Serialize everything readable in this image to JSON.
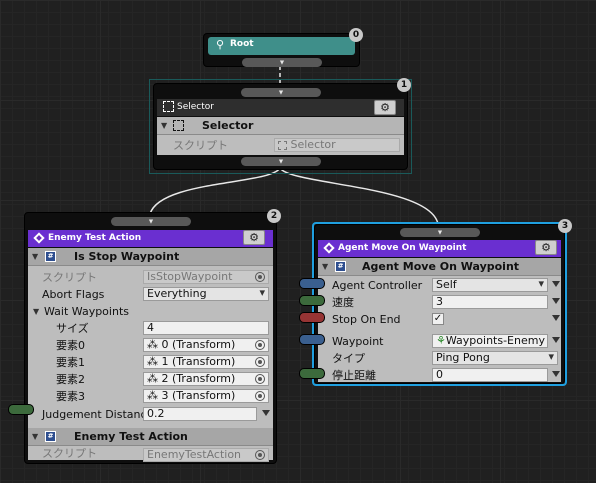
{
  "colors": {
    "root_title": "#3f8f8a",
    "selector_title": "#2e2e2e",
    "action_title": "#6a2fd0",
    "selected_outline": "#1f9fdf",
    "port_blue": "#3a5f8f",
    "port_green": "#3c6a3c",
    "port_red": "#963434"
  },
  "root": {
    "title": "Root",
    "badge": "0",
    "icon": "map-pin-icon"
  },
  "selector": {
    "title": "Selector",
    "badge": "1",
    "header": "Selector",
    "script_label": "スクリプト",
    "script_value": "Selector",
    "icon": "selector-icon"
  },
  "enemy": {
    "title": "Enemy Test Action",
    "badge": "2",
    "comp1_header": "Is Stop Waypoint",
    "script_label": "スクリプト",
    "script_value": "IsStopWaypoint",
    "abort_label": "Abort Flags",
    "abort_value": "Everything",
    "wait_label": "Wait Waypoints",
    "size_label": "サイズ",
    "size_value": "4",
    "elements": [
      {
        "label": "要素0",
        "value": "0 (Transform)"
      },
      {
        "label": "要素1",
        "value": "1 (Transform)"
      },
      {
        "label": "要素2",
        "value": "2 (Transform)"
      },
      {
        "label": "要素3",
        "value": "3 (Transform)"
      }
    ],
    "judge_label": "Judgement Distance",
    "judge_value": "0.2",
    "comp2_header": "Enemy Test Action",
    "script2_label": "スクリプト",
    "script2_value": "EnemyTestAction"
  },
  "agent": {
    "title": "Agent Move On Waypoint",
    "badge": "3",
    "comp_header": "Agent Move On Waypoint",
    "controller_label": "Agent Controller",
    "controller_value": "Self",
    "speed_label": "速度",
    "speed_value": "3",
    "stop_label": "Stop On End",
    "stop_checked": "✓",
    "waypoint_label": "Waypoint",
    "waypoint_value": "Waypoints-Enemy",
    "type_label": "タイプ",
    "type_value": "Ping Pong",
    "stopdist_label": "停止距離",
    "stopdist_value": "0"
  }
}
